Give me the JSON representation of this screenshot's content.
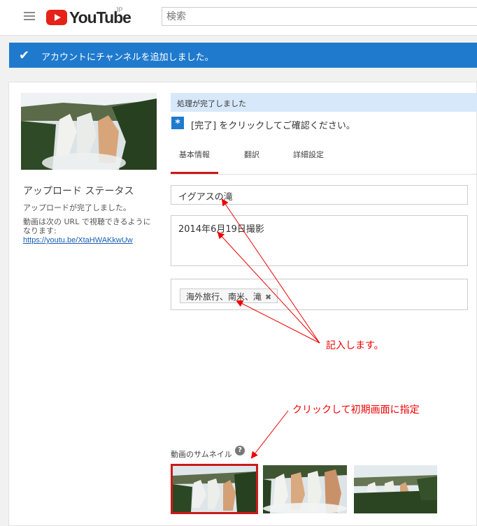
{
  "header": {
    "logo_text": "YouTube",
    "region": "JP",
    "search_placeholder": "検索"
  },
  "notice": {
    "message": "アカウントにチャンネルを追加しました。"
  },
  "upload_status": {
    "title": "アップロード ステータス",
    "done_text": "アップロードが完了しました。",
    "url_label": "動画は次の URL で視聴できるようになります:",
    "url": "https://youtu.be/XtaHWAKkwUw"
  },
  "processing": {
    "banner": "処理が完了しました",
    "info": "[完了] をクリックしてご確認ください。"
  },
  "tabs": [
    {
      "label": "基本情報",
      "active": true
    },
    {
      "label": "翻訳",
      "active": false
    },
    {
      "label": "詳細設定",
      "active": false
    }
  ],
  "form": {
    "title_value": "イグアスの滝",
    "description_value": "2014年6月19日撮影",
    "tag_value": "海外旅行、南米、滝"
  },
  "annotations": {
    "fill_in": "記入します。",
    "click_note": "クリックして初期画面に指定"
  },
  "thumbnail": {
    "label": "動画のサムネイル",
    "help": "?"
  },
  "colors": {
    "accent": "#1f7acd",
    "annotation": "#e00000",
    "tab_active": "#cc181e"
  }
}
